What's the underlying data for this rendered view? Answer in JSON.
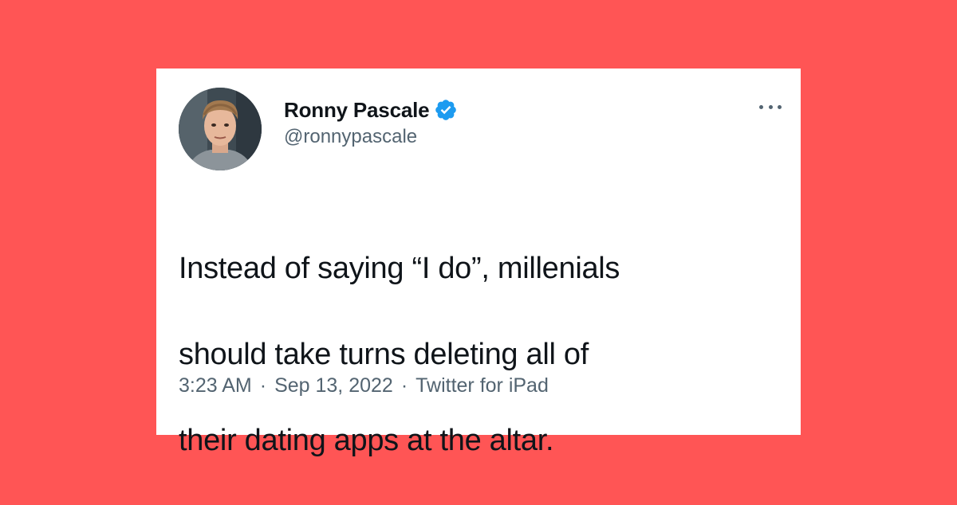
{
  "colors": {
    "background": "#ff5555",
    "card": "#ffffff",
    "text_primary": "#0f1419",
    "text_secondary": "#536471",
    "verified": "#1d9bf0"
  },
  "tweet": {
    "author": {
      "display_name": "Ronny Pascale",
      "handle": "@ronnypascale",
      "verified": true,
      "avatar_icon": "user-avatar-photo"
    },
    "more_icon": "more-horizontal-icon",
    "text_lines": [
      "Instead of saying “I do”, millenials",
      "should take turns deleting all of",
      "their dating apps at the altar."
    ],
    "meta": {
      "time": "3:23 AM",
      "date": "Sep 13, 2022",
      "source": "Twitter for iPad",
      "separator": "·"
    }
  }
}
